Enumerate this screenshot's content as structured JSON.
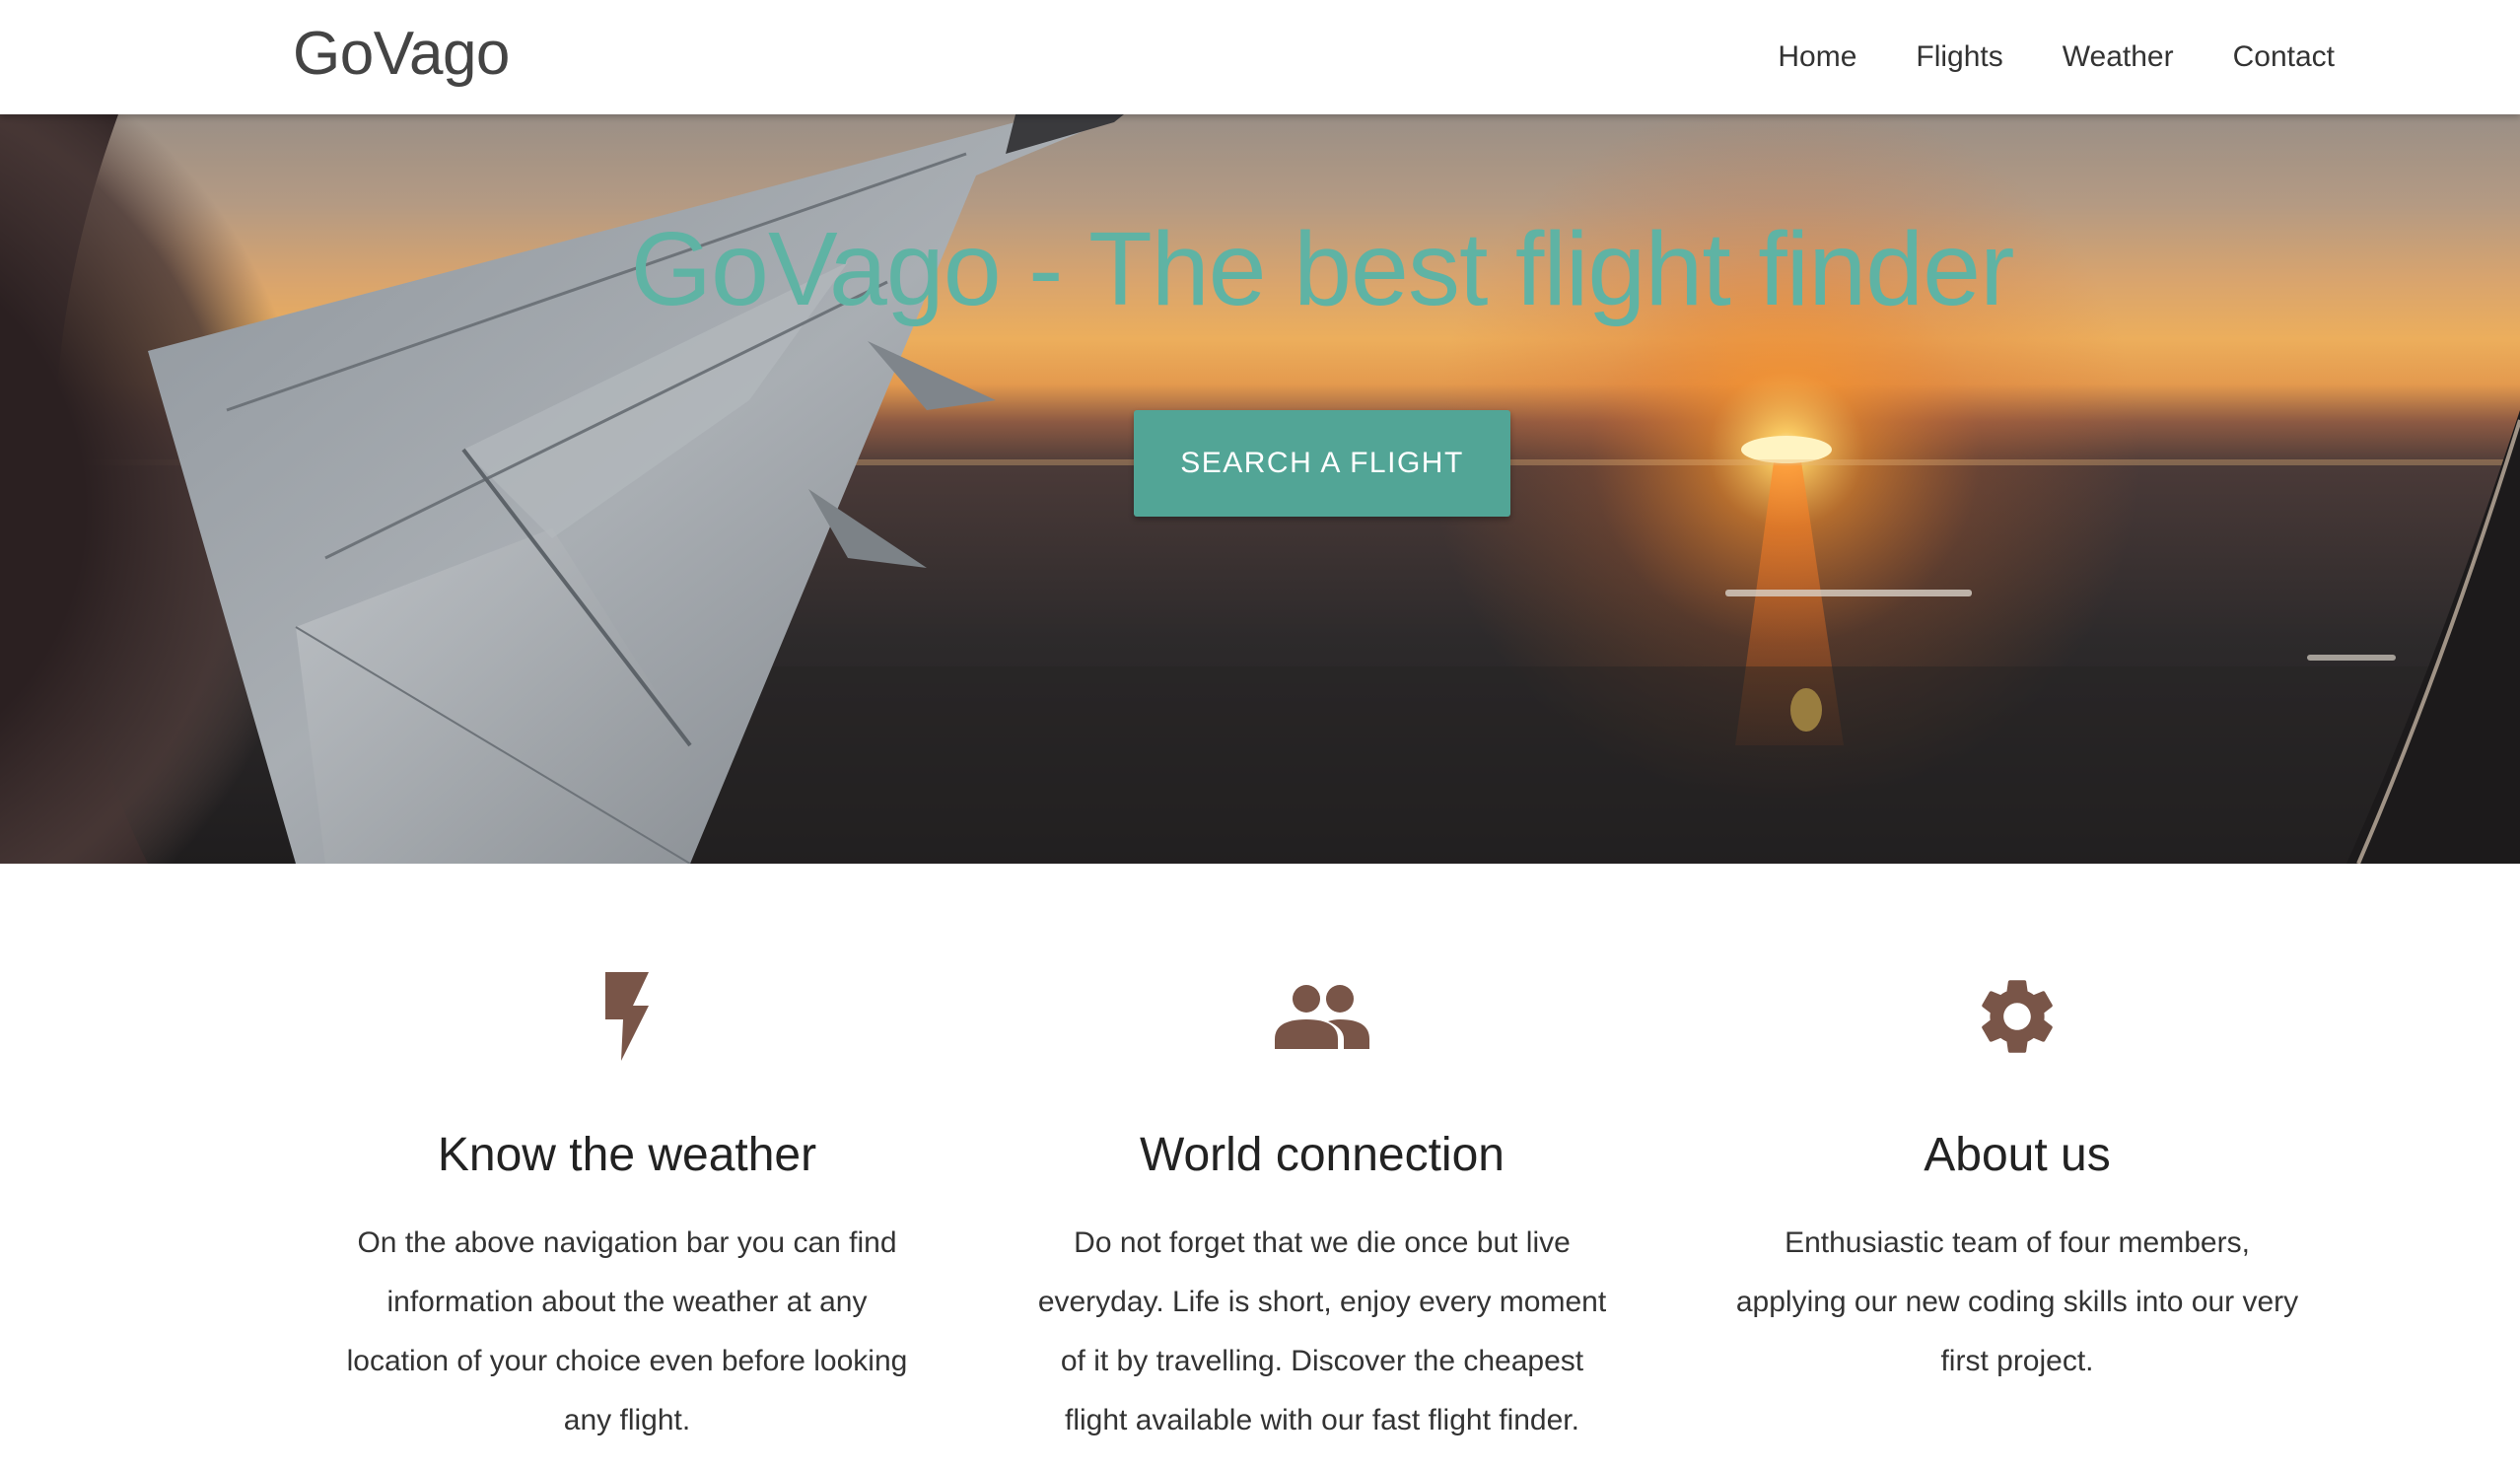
{
  "navbar": {
    "brand": "GoVago",
    "links": [
      "Home",
      "Flights",
      "Weather",
      "Contact"
    ]
  },
  "hero": {
    "title": "GoVago - The best flight finder",
    "button_label": "SEARCH A FLIGHT",
    "image": "airplane-wing-sunset-photo"
  },
  "features": [
    {
      "icon": "flash-icon",
      "title": "Know the weather",
      "lines": [
        "On the above navigation bar you can find",
        "information about the weather at any",
        "location of your choice even before looking",
        "any flight."
      ]
    },
    {
      "icon": "people-icon",
      "title": "World connection",
      "lines": [
        "Do not forget that we die once but live",
        "everyday. Life is short, enjoy every moment",
        "of it by travelling. Discover the cheapest",
        "flight available with our fast flight finder."
      ]
    },
    {
      "icon": "gear-icon",
      "title": "About us",
      "lines": [
        "Enthusiastic team of four members,",
        "applying our new coding skills into our very",
        "first project."
      ]
    }
  ],
  "colors": {
    "accent": "#52a596",
    "hero_title": "#5fb3a4",
    "icon": "#795548"
  }
}
